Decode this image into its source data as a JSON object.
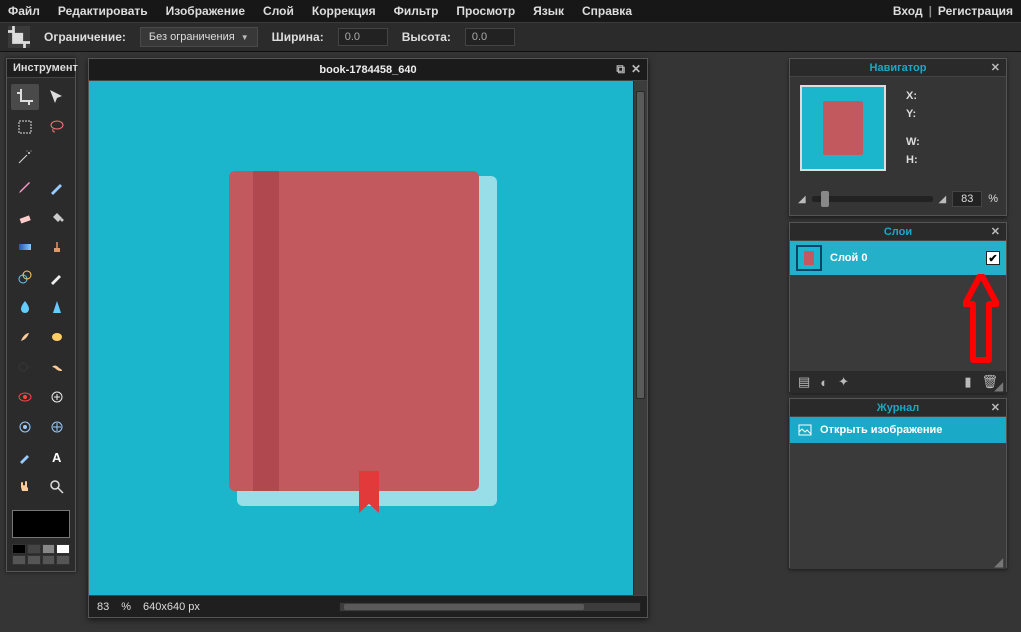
{
  "menu": {
    "file": "Файл",
    "edit": "Редактировать",
    "image": "Изображение",
    "layer": "Слой",
    "adjust": "Коррекция",
    "filter": "Фильтр",
    "view": "Просмотр",
    "lang": "Язык",
    "help": "Справка"
  },
  "auth": {
    "login": "Вход",
    "register": "Регистрация"
  },
  "options": {
    "constraint_label": "Ограничение:",
    "constraint_value": "Без ограничения",
    "width_label": "Ширина:",
    "width_value": "0.0",
    "height_label": "Высота:",
    "height_value": "0.0"
  },
  "toolpanel": {
    "title": "Инструмент"
  },
  "doc": {
    "title": "book-1784458_640",
    "zoom": "83",
    "zoom_pct": "%",
    "dims": "640x640 px"
  },
  "navigator": {
    "title": "Навигатор",
    "X": "X:",
    "Y": "Y:",
    "W": "W:",
    "H": "H:",
    "zoom": "83",
    "zoom_pct": "%"
  },
  "layers": {
    "title": "Слои",
    "layer0": "Слой 0"
  },
  "history": {
    "title": "Журнал",
    "open": "Открыть изображение"
  }
}
